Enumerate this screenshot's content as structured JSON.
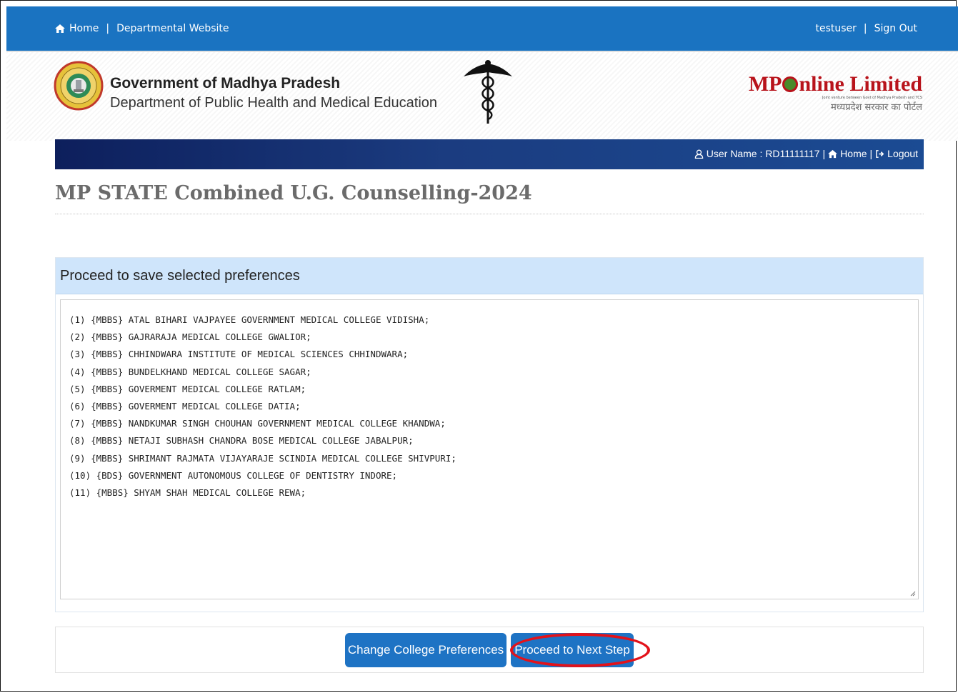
{
  "topbar": {
    "home_label": "Home",
    "separator": "|",
    "dept_site_label": "Departmental Website",
    "username": "testuser",
    "signout_label": "Sign Out"
  },
  "header": {
    "gov_title": "Government of Madhya Pradesh",
    "gov_subtitle": "Department of Public Health and Medical Education",
    "mponline_main": "MPOnline Limited",
    "mponline_tagline": "Joint venture between Govt of Madhya Pradesh and TCS",
    "mponline_hindi": "मध्यप्रदेश सरकार का पोर्टल"
  },
  "userbar": {
    "user_name_label": "User Name : RD11111117",
    "home_label": "Home",
    "logout_label": "Logout",
    "separator": "|"
  },
  "page": {
    "title": "MP STATE Combined U.G. Counselling-2024"
  },
  "panel": {
    "heading": "Proceed to save selected preferences",
    "preferences": [
      "(1) {MBBS} ATAL BIHARI VAJPAYEE GOVERNMENT MEDICAL COLLEGE VIDISHA;",
      "(2) {MBBS} GAJRARAJA MEDICAL COLLEGE GWALIOR;",
      "(3) {MBBS} CHHINDWARA INSTITUTE OF MEDICAL SCIENCES CHHINDWARA;",
      "(4) {MBBS} BUNDELKHAND MEDICAL COLLEGE SAGAR;",
      "(5) {MBBS} GOVERMENT MEDICAL COLLEGE RATLAM;",
      "(6) {MBBS} GOVERMENT MEDICAL COLLEGE DATIA;",
      "(7) {MBBS} NANDKUMAR SINGH CHOUHAN GOVERNMENT MEDICAL COLLEGE KHANDWA;",
      "(8) {MBBS} NETAJI SUBHASH CHANDRA BOSE MEDICAL COLLEGE JABALPUR;",
      "(9) {MBBS} SHRIMANT RAJMATA VIJAYARAJE SCINDIA MEDICAL COLLEGE SHIVPURI;",
      "(10) {BDS} GOVERNMENT AUTONOMOUS COLLEGE OF DENTISTRY INDORE;",
      "(11) {MBBS} SHYAM SHAH MEDICAL COLLEGE REWA;"
    ]
  },
  "actions": {
    "change_label": "Change College Preferences",
    "next_label": "Proceed to Next Step",
    "primary_color": "#1e73c4",
    "highlight_color": "#e3121a"
  }
}
